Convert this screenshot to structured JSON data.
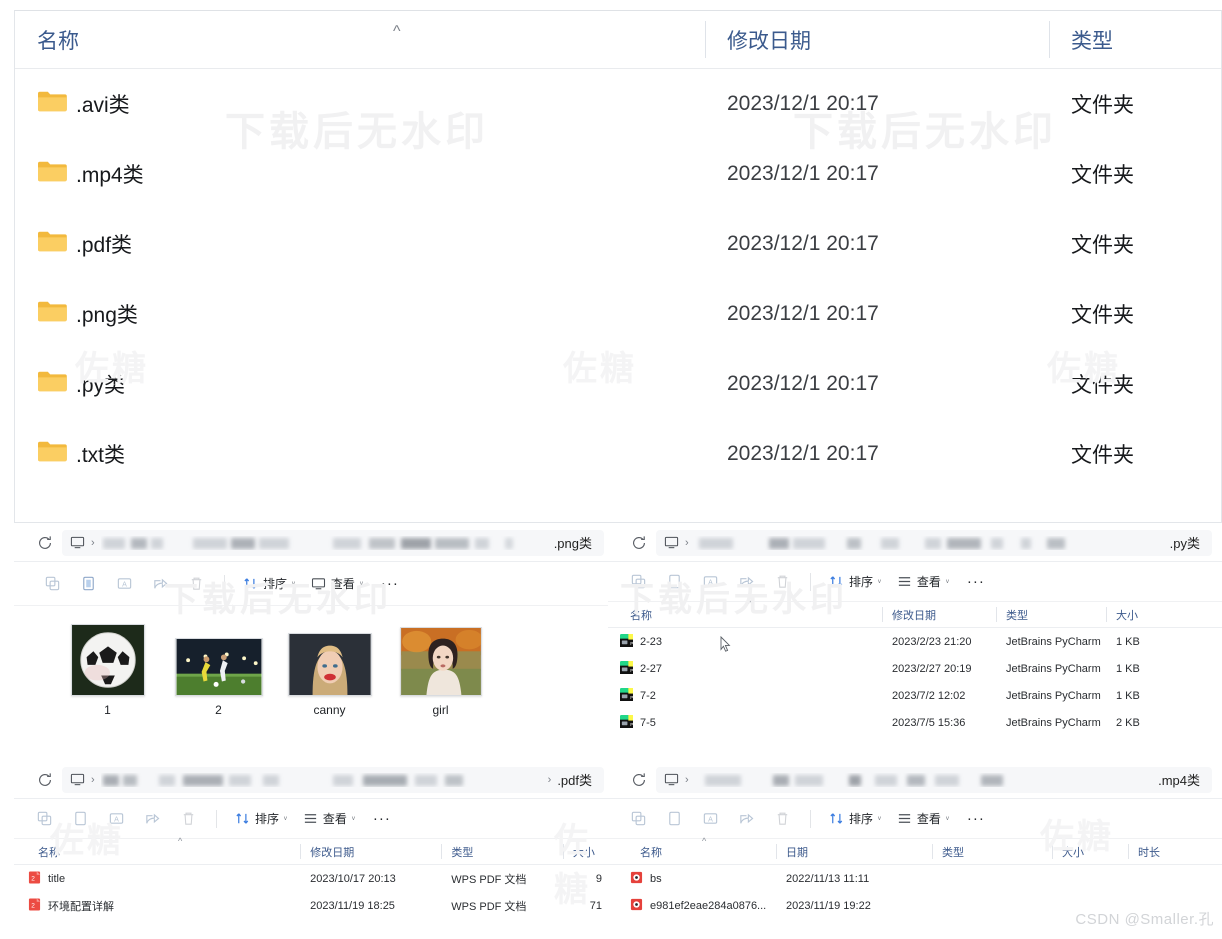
{
  "watermarks": {
    "primary": "下载后无水印",
    "secondary": "佐糖",
    "signature": "CSDN @Smaller.孔"
  },
  "top_window": {
    "name": "folder-list-window",
    "sort_indicator": "^",
    "columns": [
      {
        "key": "name",
        "label": "名称"
      },
      {
        "key": "date",
        "label": "修改日期"
      },
      {
        "key": "type",
        "label": "类型"
      }
    ],
    "rows": [
      {
        "name": ".avi类",
        "date": "2023/12/1 20:17",
        "type": "文件夹",
        "icon": "folder-icon"
      },
      {
        "name": ".mp4类",
        "date": "2023/12/1 20:17",
        "type": "文件夹",
        "icon": "folder-icon"
      },
      {
        "name": ".pdf类",
        "date": "2023/12/1 20:17",
        "type": "文件夹",
        "icon": "folder-icon"
      },
      {
        "name": ".png类",
        "date": "2023/12/1 20:17",
        "type": "文件夹",
        "icon": "folder-icon"
      },
      {
        "name": ".py类",
        "date": "2023/12/1 20:17",
        "type": "文件夹",
        "icon": "folder-icon"
      },
      {
        "name": ".txt类",
        "date": "2023/12/1 20:17",
        "type": "文件夹",
        "icon": "folder-icon"
      }
    ]
  },
  "toolbar": {
    "icons": [
      "copy-icon",
      "paste-icon",
      "rename-icon",
      "share-icon",
      "delete-icon"
    ],
    "sort_label": "排序",
    "view_label": "查看",
    "more_label": "···",
    "caret": "ᵛ"
  },
  "png_window": {
    "name": "png-folder-window",
    "breadcrumb_last": ".png类",
    "chevron": "›",
    "view_mode": "icons",
    "items": [
      {
        "label": "1",
        "thumb": "soccer-ball-thumbnail"
      },
      {
        "label": "2",
        "thumb": "soccer-players-thumbnail"
      },
      {
        "label": "canny",
        "thumb": "portrait-blonde-thumbnail"
      },
      {
        "label": "girl",
        "thumb": "portrait-autumn-thumbnail"
      }
    ]
  },
  "py_window": {
    "name": "py-folder-window",
    "breadcrumb_last": ".py类",
    "chevron": "›",
    "sort_indicator": "^",
    "columns": [
      {
        "key": "name",
        "label": "名称"
      },
      {
        "key": "date",
        "label": "修改日期"
      },
      {
        "key": "type",
        "label": "类型"
      },
      {
        "key": "size",
        "label": "大小"
      }
    ],
    "rows": [
      {
        "name": "2-23",
        "date": "2023/2/23 21:20",
        "type": "JetBrains PyCharm",
        "size": "1 KB",
        "icon": "pycharm-file-icon"
      },
      {
        "name": "2-27",
        "date": "2023/2/27 20:19",
        "type": "JetBrains PyCharm",
        "size": "1 KB",
        "icon": "pycharm-file-icon"
      },
      {
        "name": "7-2",
        "date": "2023/7/2 12:02",
        "type": "JetBrains PyCharm",
        "size": "1 KB",
        "icon": "pycharm-file-icon"
      },
      {
        "name": "7-5",
        "date": "2023/7/5 15:36",
        "type": "JetBrains PyCharm",
        "size": "2 KB",
        "icon": "pycharm-file-icon"
      }
    ]
  },
  "pdf_window": {
    "name": "pdf-folder-window",
    "breadcrumb_last": ".pdf类",
    "chevron": "›",
    "sort_indicator": "^",
    "columns": [
      {
        "key": "name",
        "label": "名称"
      },
      {
        "key": "date",
        "label": "修改日期"
      },
      {
        "key": "type",
        "label": "类型"
      },
      {
        "key": "size",
        "label": "大小"
      }
    ],
    "rows": [
      {
        "name": "title",
        "date": "2023/10/17 20:13",
        "type": "WPS PDF 文档",
        "size": "9",
        "icon": "pdf-file-icon"
      },
      {
        "name": "环境配置详解",
        "date": "2023/11/19 18:25",
        "type": "WPS PDF 文档",
        "size": "71",
        "icon": "pdf-file-icon"
      }
    ]
  },
  "mp4_window": {
    "name": "mp4-folder-window",
    "breadcrumb_last": ".mp4类",
    "chevron": "›",
    "sort_indicator": "^",
    "columns": [
      {
        "key": "name",
        "label": "名称"
      },
      {
        "key": "date",
        "label": "日期"
      },
      {
        "key": "type",
        "label": "类型"
      },
      {
        "key": "size",
        "label": "大小"
      },
      {
        "key": "duration",
        "label": "时长"
      }
    ],
    "rows": [
      {
        "name": "bs",
        "date": "2022/11/13 11:11",
        "type": "",
        "size": "",
        "duration": "",
        "icon": "video-file-icon"
      },
      {
        "name": "e981ef2eae284a0876...",
        "date": "2023/11/19 19:22",
        "type": "",
        "size": "",
        "duration": "",
        "icon": "video-file-icon"
      }
    ]
  },
  "colors": {
    "header_blue": "#3b5a8d",
    "folder_yellow": "#f7c54a",
    "pdf_red": "#e8413a",
    "accent_blue": "#3c7de0"
  }
}
